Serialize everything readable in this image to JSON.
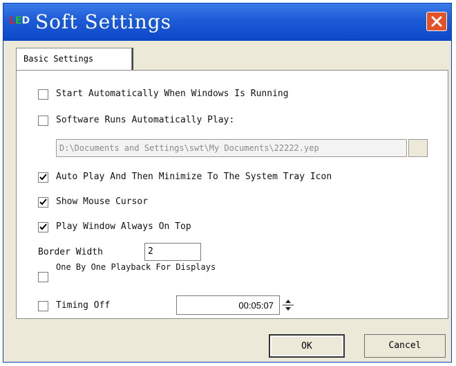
{
  "window": {
    "title": "Soft Settings",
    "icon_text": "LED",
    "icon_colors": [
      "#e02020",
      "#20c020",
      "#f0f0f0"
    ],
    "title_color": "#ffffff",
    "titlebar_color": "#1c5bd6",
    "close_color": "#e2532a"
  },
  "tabs": [
    {
      "label": "Basic Settings",
      "selected": true
    }
  ],
  "options": {
    "start_auto": {
      "label": "Start Automatically When Windows Is Running",
      "checked": false
    },
    "software_runs": {
      "label": "Software Runs Automatically Play:",
      "checked": false
    },
    "play_file_path": "D:\\Documents and Settings\\swt\\My Documents\\22222.yep",
    "auto_play_minimize": {
      "label": "Auto Play And Then Minimize To The System Tray Icon",
      "checked": true
    },
    "show_mouse": {
      "label": "Show Mouse Cursor",
      "checked": true
    },
    "always_on_top": {
      "label": "Play Window Always On Top",
      "checked": true
    },
    "border_width": {
      "label": "Border Width",
      "value": "2"
    },
    "one_by_one": {
      "label": "One By One Playback For Displays",
      "checked": false
    },
    "timing_off": {
      "label": "Timing Off",
      "checked": false,
      "time": "00:05:07"
    }
  },
  "buttons": {
    "ok": "OK",
    "cancel": "Cancel"
  },
  "icons": [
    "app-led-icon",
    "close-icon",
    "check-icon",
    "spinner-up-down-icon"
  ]
}
